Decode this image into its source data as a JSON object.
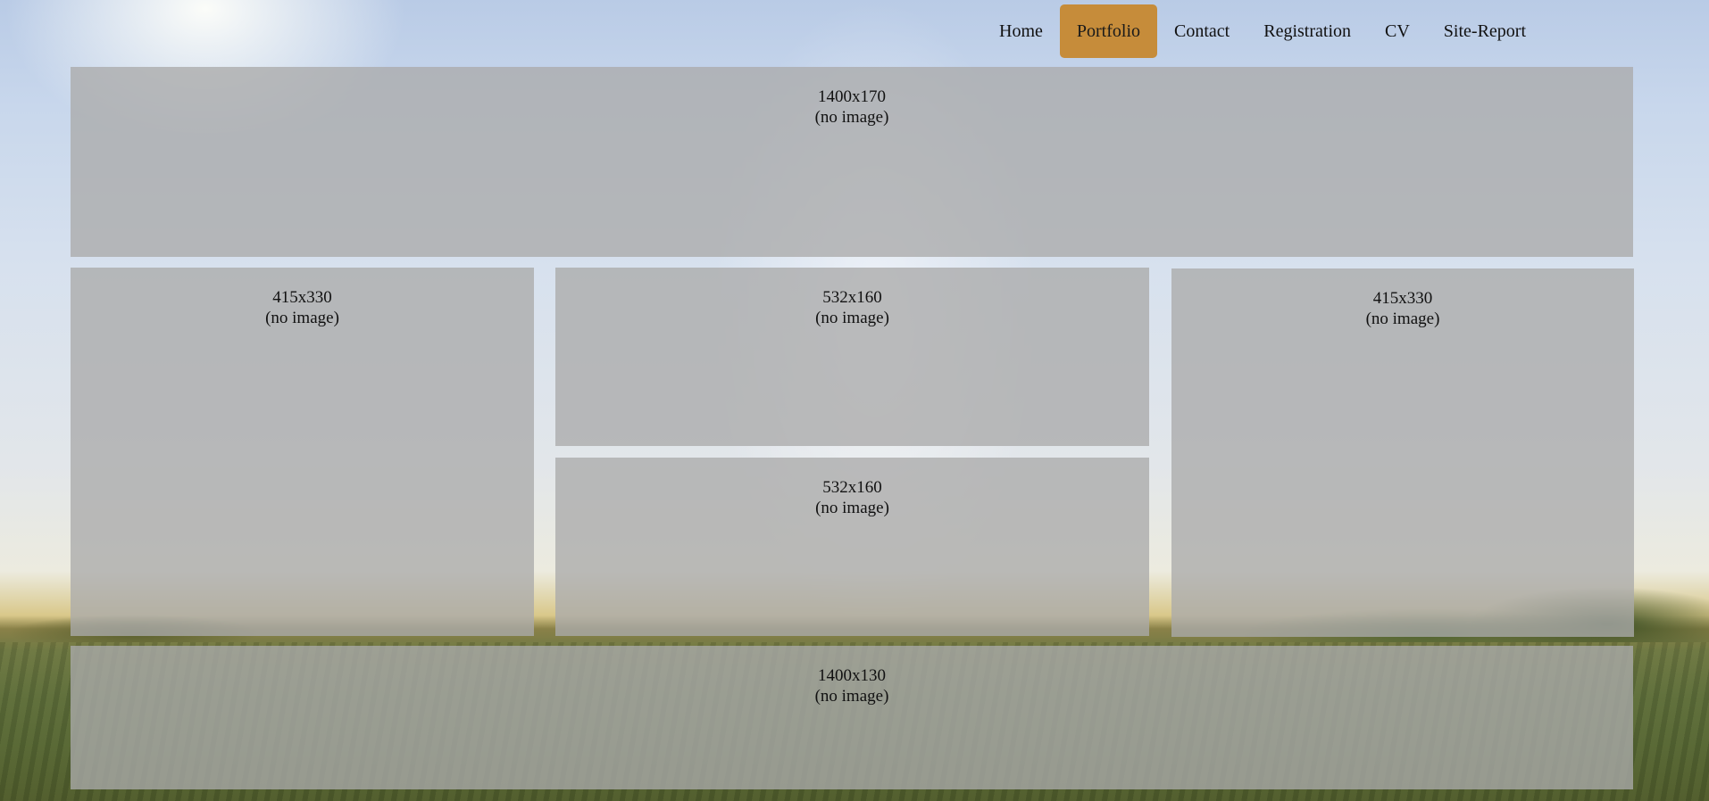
{
  "nav": {
    "items": [
      {
        "label": "Home"
      },
      {
        "label": "Portfolio"
      },
      {
        "label": "Contact"
      },
      {
        "label": "Registration"
      },
      {
        "label": "CV"
      },
      {
        "label": "Site-Report"
      }
    ],
    "active": "Portfolio"
  },
  "colors": {
    "nav_active": "#c68c3a",
    "tile": "#aaaaaa"
  },
  "tiles": [
    {
      "size": "1400x170",
      "note": "(no image)"
    },
    {
      "size": "415x330",
      "note": "(no image)"
    },
    {
      "size": "532x160",
      "note": "(no image)"
    },
    {
      "size": "415x330",
      "note": "(no image)"
    },
    {
      "size": "532x160",
      "note": "(no image)"
    },
    {
      "size": "1400x130",
      "note": "(no image)"
    }
  ]
}
